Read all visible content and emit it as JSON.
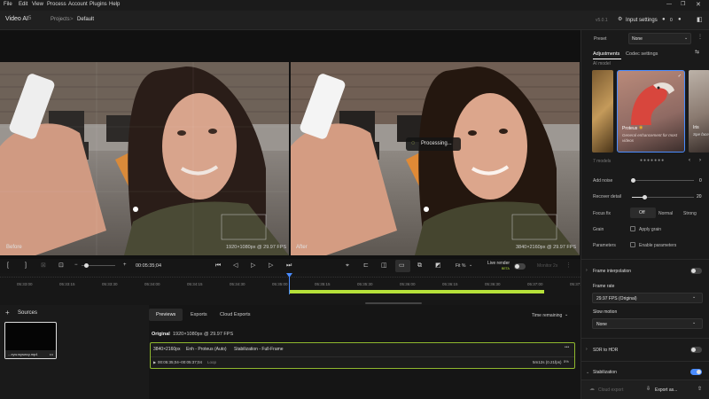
{
  "menu": [
    "File",
    "Edit",
    "View",
    "Process",
    "Account",
    "Plugins",
    "Help"
  ],
  "app": {
    "name": "Video AI",
    "version_badge": "5",
    "breadcrumb_projects": "Projects",
    "breadcrumb_sep": ">",
    "breadcrumb_current": "Default",
    "version": "v5.0.1",
    "input_settings": "Input settings",
    "notif_count": "0"
  },
  "preview": {
    "before_label": "Before",
    "before_info": "1920×1080px @ 29.97 FPS",
    "after_label": "After",
    "after_info": "3840×2160px @ 29.97 FPS",
    "processing": "Processing..."
  },
  "controls": {
    "timecode": "00:05:35;04",
    "fit": "Fit %",
    "live_render": "Live render",
    "live_render_badge": "BETA",
    "monitor": "Monitor 2x"
  },
  "timeline": {
    "ticks": [
      "05:33:00",
      "05:33:15",
      "05:33:30",
      "05:34:00",
      "05:34:15",
      "05:34:30",
      "05:35:00",
      "05:35:15",
      "05:35:30",
      "05:36:00",
      "05:36:15",
      "05:36:30",
      "05:37:00",
      "05:37:15"
    ]
  },
  "sources": {
    "title": "Sources",
    "thumb_name": "...xyw.wyswcy.mp4"
  },
  "tabs": [
    "Previews",
    "Exports",
    "Cloud Exports"
  ],
  "time_remaining": "Time remaining",
  "original": {
    "label": "Original",
    "info": "1920×1080px @ 29.97 FPS"
  },
  "job": {
    "res": "3840×2160px",
    "enh": "Enh - Proteus (Auto)",
    "stab": "Stabilization - Full-Frame",
    "range": "00:05:35;04–00:05:37;04",
    "loop": "Loop",
    "eta": "5m12s (0.21fps)",
    "pct": "5%"
  },
  "panel": {
    "preset_label": "Preset",
    "preset_value": "None",
    "tab_adjust": "Adjustments",
    "tab_codec": "Codec settings",
    "ai_model": "AI model",
    "model_name": "Proteus",
    "model_desc": "General enhancement for most videos",
    "model3_name": "Iris",
    "model3_desc": "Spe face",
    "models_count": "7 models",
    "add_noise": "Add noise",
    "add_noise_val": "0",
    "recover_detail": "Recover detail",
    "recover_detail_val": "20",
    "focus_fix": "Focus fix",
    "focus_off": "Off",
    "focus_normal": "Normal",
    "focus_strong": "Strong",
    "grain": "Grain",
    "apply_grain": "Apply grain",
    "parameters": "Parameters",
    "enable_params": "Enable parameters",
    "frame_interp": "Frame interpolation",
    "frame_rate": "Frame rate",
    "frame_rate_val": "29.97 FPS (Original)",
    "slow_motion": "Slow motion",
    "slow_motion_val": "None",
    "sdr_hdr": "SDR to HDR",
    "stabilization": "Stabilization",
    "cloud_export": "Cloud export",
    "export_as": "Export as..."
  },
  "colors": {
    "accent": "#4a8cff",
    "progress": "#b6e13a",
    "playhead": "#4a8cff"
  }
}
